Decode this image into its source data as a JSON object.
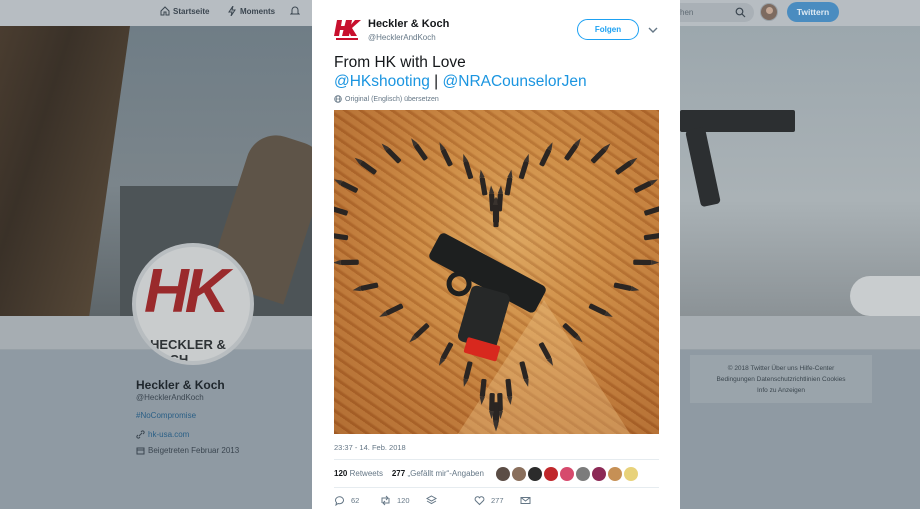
{
  "nav": {
    "home": "Startseite",
    "moments": "Moments",
    "search_placeholder": "hen",
    "tweet_button": "Twittern"
  },
  "profile": {
    "avatar_logo_text": "HK",
    "avatar_name_text": "HECKLER & KOCH",
    "name": "Heckler & Koch",
    "handle": "@HecklerAndKoch",
    "hashtag": "#NoCompromise",
    "website": "hk-usa.com",
    "joined": "Beigetreten Februar 2013"
  },
  "footer": {
    "line1": "© 2018 Twitter    Über uns    Hilfe-Center",
    "line2": "Bedingungen    Datenschutzrichtlinien    Cookies",
    "line3": "Info zu Anzeigen"
  },
  "tweet": {
    "author_name": "Heckler & Koch",
    "author_handle": "@HecklerAndKoch",
    "follow_label": "Folgen",
    "text_line1": "From HK with Love",
    "mention1": "@HKshooting",
    "separator": " | ",
    "mention2": "@NRACounselorJen",
    "translate_label": "Original (Englisch) übersetzen",
    "timestamp": "23:37 - 14. Feb. 2018",
    "retweets_count": "120",
    "retweets_label": "Retweets",
    "likes_count": "277",
    "likes_label": "„Gefällt mir“-Angaben",
    "reply_count": "62",
    "retweet_action_count": "120",
    "like_action_count": "277"
  },
  "colors": {
    "accent": "#1da1f2",
    "mention": "#1b95e0",
    "brand_red": "#c8102e"
  },
  "icons": [
    "home-icon",
    "lightning-icon",
    "bell-icon",
    "search-icon",
    "globe-icon",
    "link-icon",
    "calendar-icon",
    "reply-icon",
    "retweet-icon",
    "layers-icon",
    "heart-icon",
    "mail-icon",
    "chevron-down-icon"
  ]
}
